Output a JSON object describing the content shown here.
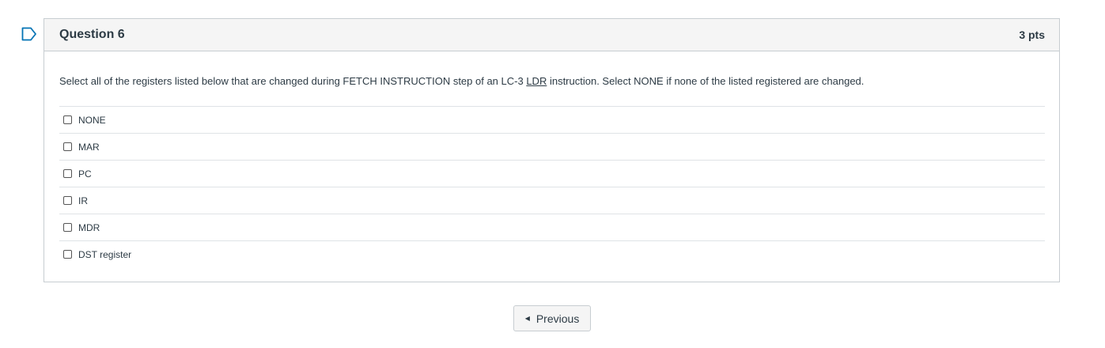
{
  "question": {
    "flag_icon": "flag-outline-icon",
    "title": "Question 6",
    "points": "3 pts",
    "text_before": "Select all of the registers listed below that are changed during FETCH INSTRUCTION step of an LC-3 ",
    "text_ldr": "LDR",
    "text_after": " instruction. Select NONE if none of the listed registered are changed.",
    "answers": [
      {
        "label": "NONE",
        "checked": false
      },
      {
        "label": "MAR",
        "checked": false
      },
      {
        "label": "PC",
        "checked": false
      },
      {
        "label": "IR",
        "checked": false
      },
      {
        "label": "MDR",
        "checked": false
      },
      {
        "label": "DST register",
        "checked": false
      }
    ]
  },
  "navigation": {
    "previous_label": "Previous",
    "previous_icon": "triangle-left-icon"
  },
  "colors": {
    "flag": "#0374b5",
    "header_bg": "#f5f5f5",
    "border": "#c7cdd1",
    "text": "#2d3b45"
  }
}
